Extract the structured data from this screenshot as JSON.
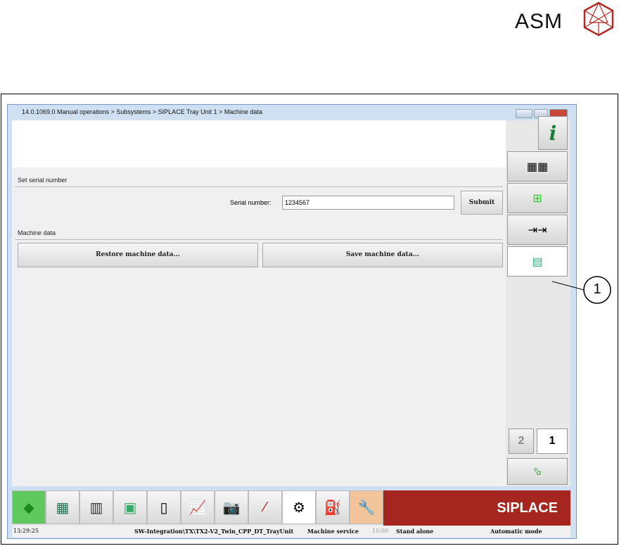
{
  "logo": {
    "text": "ASM",
    "color": "#b22a25"
  },
  "window": {
    "title": "14.0.1069.0 Manual operations > Subsystems > SIPLACE Tray Unit 1 > Machine data"
  },
  "serial": {
    "section": "Set serial number",
    "label": "Serial number:",
    "value": "1234567",
    "submit": "Submit"
  },
  "machine": {
    "section": "Machine data",
    "restore": "Restore machine data...",
    "save": "Save machine data..."
  },
  "side": {
    "info": "i",
    "page2": "2",
    "page1": "1"
  },
  "callout": "1",
  "brand": "SIPLACE",
  "status": {
    "time": "13:29:25",
    "path": "SW-Integration\\TX\\TX2-V2_Twin_CPP_DT_TrayUnit",
    "user": "Machine service",
    "clock": "10:00",
    "mode1": "Stand alone",
    "mode2": "Automatic mode"
  }
}
